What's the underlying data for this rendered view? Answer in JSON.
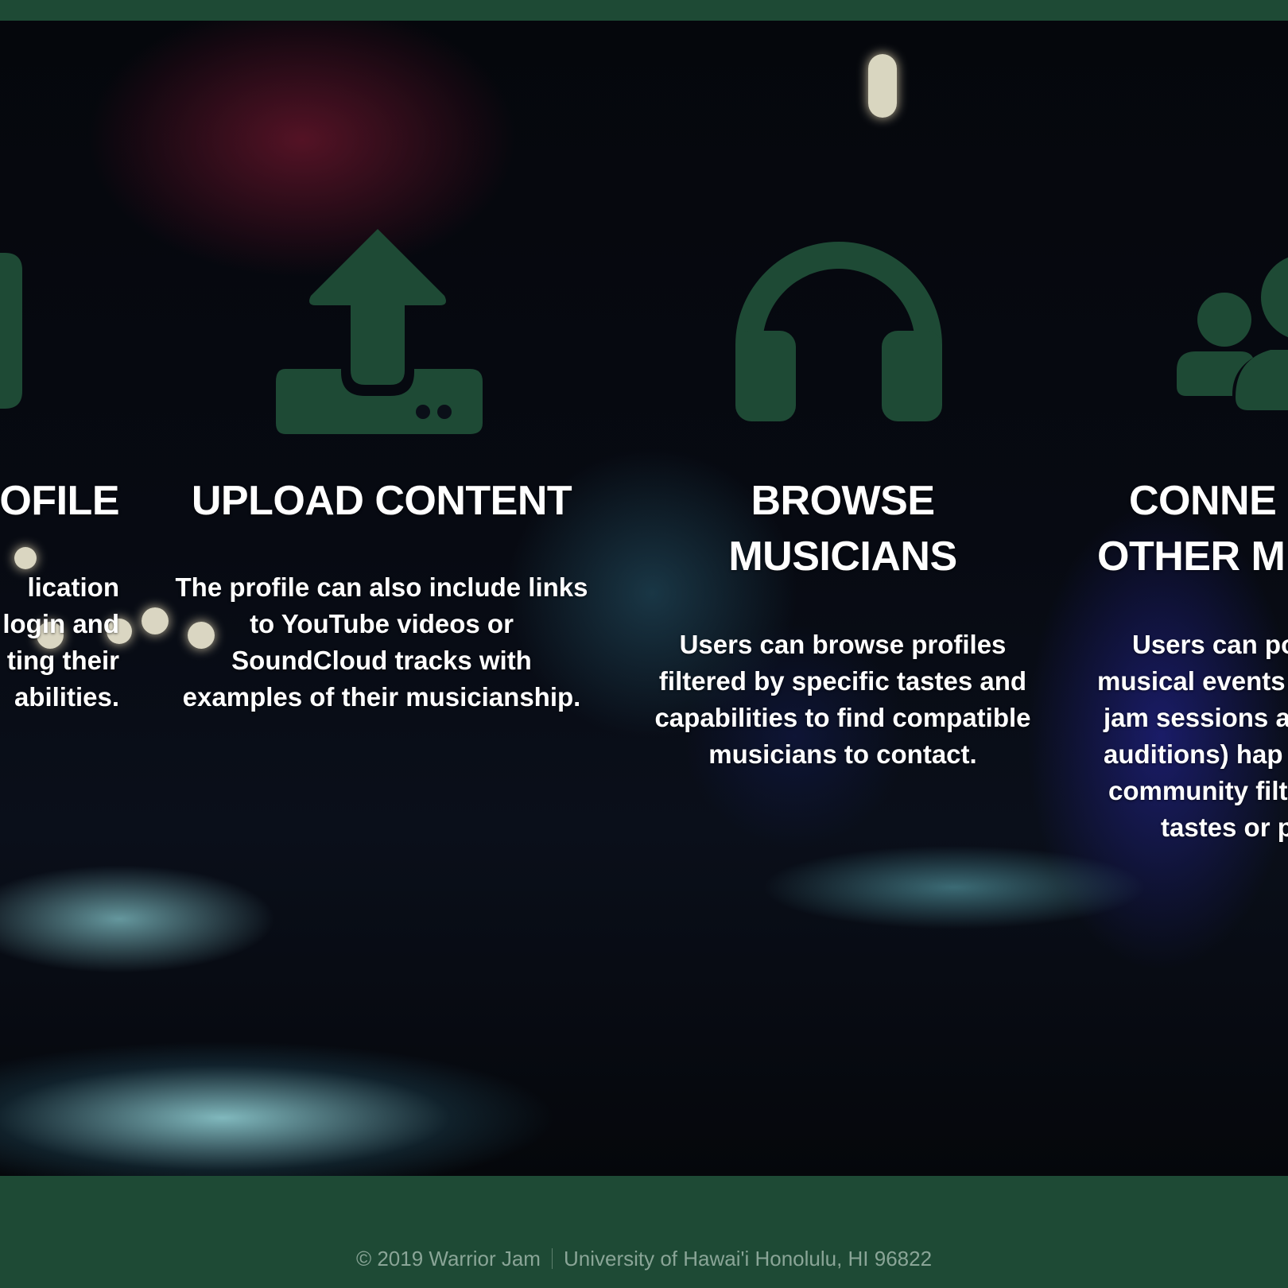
{
  "features": [
    {
      "icon": "profile-icon",
      "title": "OFILE",
      "description": [
        "lication",
        "login and",
        "ting their",
        "abilities."
      ]
    },
    {
      "icon": "upload-icon",
      "title": "UPLOAD CONTENT",
      "description": [
        "The profile can also include links",
        "to YouTube videos or",
        "SoundCloud tracks with",
        "examples of their musicianship."
      ]
    },
    {
      "icon": "headphones-icon",
      "title_lines": [
        "BROWSE",
        "MUSICIANS"
      ],
      "description": [
        "Users can browse profiles",
        "filtered by specific tastes and",
        "capabilities to find compatible",
        "musicians to contact."
      ]
    },
    {
      "icon": "users-icon",
      "title_lines": [
        "CONNE",
        "OTHER M"
      ],
      "description": [
        "Users can po",
        "musical events",
        "jam sessions ar",
        "auditions) hap",
        "community filt",
        "tastes or p"
      ]
    }
  ],
  "footer": {
    "copyright": "© 2019 Warrior Jam",
    "address": "University of Hawai'i Honolulu, HI 96822"
  },
  "colors": {
    "brand_green": "#1e4a35",
    "text_white": "#ffffff",
    "footer_text": "#8aa597"
  }
}
